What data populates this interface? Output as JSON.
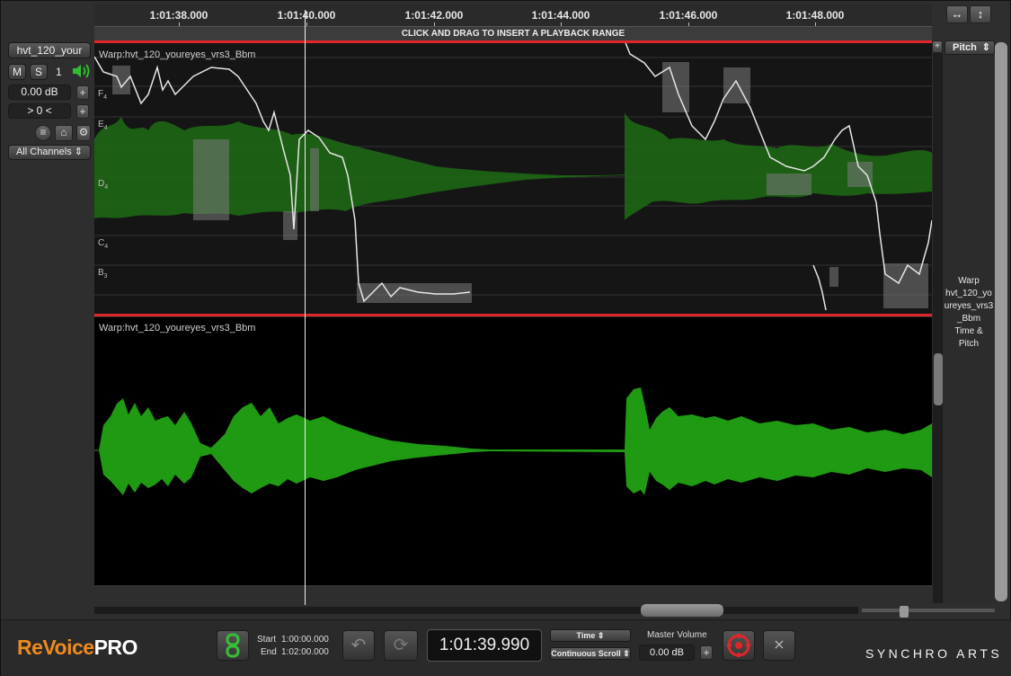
{
  "app": {
    "title": "ReVoice PRO",
    "logo_left": "ReVoice",
    "logo_right": "PRO",
    "brand_right": "SYNCHRO ARTS"
  },
  "ruler": {
    "ticks": [
      "1:01:38.000",
      "1:01:40.000",
      "1:01:42.000",
      "1:01:44.000",
      "1:01:46.000",
      "1:01:48.000"
    ],
    "hint": "CLICK AND DRAG TO INSERT A PLAYBACK RANGE"
  },
  "track": {
    "name": "hvt_120_your",
    "mute_label": "M",
    "solo_label": "S",
    "track_number": "1",
    "gain": "0.00 dB",
    "pan": "> 0 <",
    "channels": "All Channels"
  },
  "panes": {
    "pitch_label": "Warp:hvt_120_youreyes_vrs3_Bbm",
    "wave_label": "Warp:hvt_120_youreyes_vrs3_Bbm",
    "notes": [
      {
        "name": "F",
        "octave": "4"
      },
      {
        "name": "E",
        "octave": "4"
      },
      {
        "name": "D",
        "octave": "4"
      },
      {
        "name": "C",
        "octave": "4"
      },
      {
        "name": "B",
        "octave": "3"
      }
    ]
  },
  "right_panel": {
    "view_select": "Pitch",
    "desc_lines": [
      "Warp",
      "hvt_120_yo",
      "ureyes_vrs3",
      "_Bbm",
      "Time &",
      "Pitch"
    ]
  },
  "transport": {
    "start_label": "Start",
    "start_value": "1:00:00.000",
    "end_label": "End",
    "end_value": "1:02:00.000",
    "timecode": "1:01:39.990",
    "time_mode": "Time",
    "scroll_mode": "Continuous Scroll",
    "master_volume_label": "Master Volume",
    "master_volume": "0.00 dB"
  },
  "colors": {
    "accent": "#f08a1d",
    "wave": "#1f9a12",
    "redline": "#e0262a",
    "link_green": "#36c036"
  },
  "icons": [
    "expand-horizontal-icon",
    "expand-vertical-icon",
    "speaker-icon",
    "adjust-icon",
    "lock-icon",
    "gear-icon",
    "link-icon",
    "undo-icon",
    "loop-icon",
    "process-icon",
    "clear-icon"
  ]
}
